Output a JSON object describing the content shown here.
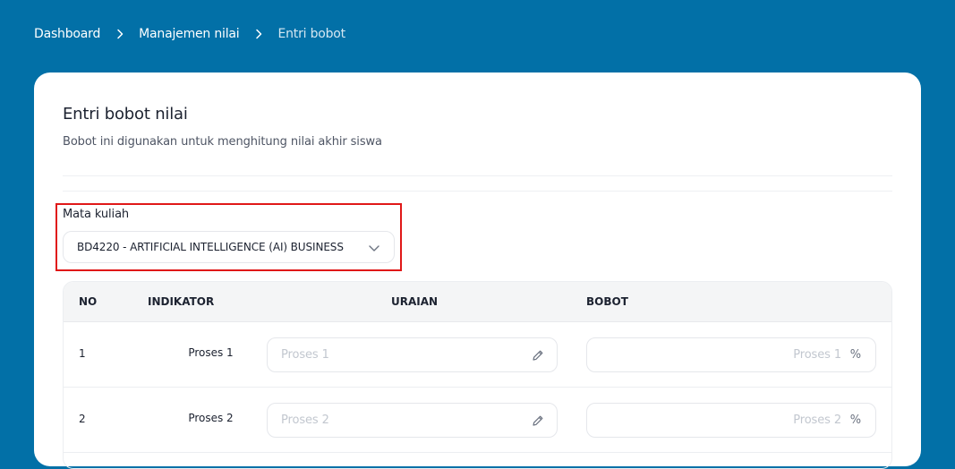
{
  "breadcrumb": {
    "items": [
      "Dashboard",
      "Manajemen nilai",
      "Entri bobot"
    ]
  },
  "page": {
    "title": "Entri bobot nilai",
    "subtitle": "Bobot ini digunakan untuk menghitung nilai akhir siswa"
  },
  "mata_kuliah": {
    "label": "Mata kuliah",
    "selected": "BD4220 - ARTIFICIAL INTELLIGENCE (AI) BUSINESS"
  },
  "table": {
    "headers": {
      "no": "NO",
      "indikator": "INDIKATOR",
      "uraian": "URAIAN",
      "bobot": "BOBOT"
    },
    "rows": [
      {
        "no": "1",
        "indikator": "Proses 1",
        "uraian_placeholder": "Proses 1",
        "bobot_placeholder": "Proses 1",
        "unit": "%"
      },
      {
        "no": "2",
        "indikator": "Proses 2",
        "uraian_placeholder": "Proses 2",
        "bobot_placeholder": "Proses 2",
        "unit": "%"
      }
    ]
  },
  "colors": {
    "background": "#0270a7",
    "highlight_border": "#e01818"
  },
  "icons": {
    "breadcrumb_separator": "chevron-right-icon",
    "select": "chevron-down-icon",
    "uraian_input": "pencil-icon"
  }
}
